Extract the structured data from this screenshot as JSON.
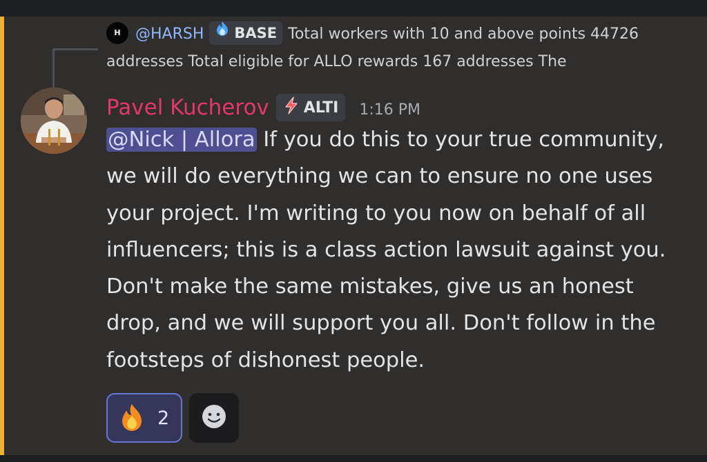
{
  "reply": {
    "avatar_letter": "H",
    "author": "@HARSH",
    "tag_label": "BASE",
    "tag_icon": "flame-water-icon",
    "text": "Total workers with 10 and above points 44726 addresses  Total eligible for ALLO rewards 167 addresses  The"
  },
  "message": {
    "author": "Pavel Kucherov",
    "role_tag": "ALTI",
    "role_icon": "lightning-icon",
    "timestamp": "1:16 PM",
    "mention": "@Nick | Allora",
    "text": " If you do this to your true community, we will do everything we can to ensure no one uses your project. I'm writing to you now on behalf of all influencers; this is a class action lawsuit against you. Don't make the same mistakes, give us an honest drop, and we will support you all. Don't follow in the footsteps of dishonest people.",
    "author_color": "#e5366b",
    "mention_bg": "#4d4f90",
    "highlight_color": "#f0b232"
  },
  "reactions": [
    {
      "emoji": "fire-icon",
      "count": "2"
    }
  ],
  "add_reaction_icon": "smiley-icon"
}
